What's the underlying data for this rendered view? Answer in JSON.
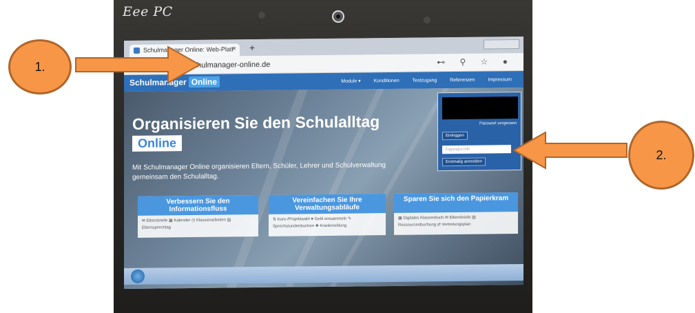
{
  "device": {
    "brand": "Eee PC"
  },
  "browser": {
    "tab_title": "Schulmanager Online: Web-Platt",
    "tab_close": "×",
    "new_tab": "+",
    "url": "schulmanager-online.de",
    "toolbar_icons": "⊷ ⚲ ☆ ●"
  },
  "site": {
    "logo_text": "Schulmanager",
    "logo_badge": "Online",
    "nav": [
      "Module ▾",
      "Konditionen",
      "Testzugang",
      "Referenzen",
      "Impressum"
    ],
    "hero_title": "Organisieren Sie den Schulalltag",
    "hero_badge": "Online",
    "hero_subtitle": "Mit Schulmanager Online organisieren Eltern, Schüler, Lehrer und Schulverwaltung gemeinsam den Schulalltag.",
    "cards": [
      {
        "title": "Verbessern Sie den Informationsfluss",
        "items": "✉ Elternbriefe   ▦ Kalender   ◷ Klassenarbeiten   ▤ Elternsprechtag"
      },
      {
        "title": "Vereinfachen Sie Ihre Verwaltungsabläufe",
        "items": "⇅ Kurs-/Projektwahl   ♥ Geld einsammeln   ✎ Sprechstundenbuchen   ✚ Krankmeldung"
      },
      {
        "title": "Sparen Sie sich den Papierkram",
        "items": "▦ Digitales Klassenbuch   ✉ Elternbriefe   ▤ Ressourcenbuchung   ⇄ Vertretungsplan"
      }
    ],
    "login": {
      "forgot": "Passwort vergessen",
      "login_button": "Einloggen",
      "code_placeholder": "Zugangscode",
      "register_button": "Erstmalig anmelden"
    }
  },
  "annotations": {
    "label_1": "1.",
    "label_2": "2."
  },
  "colors": {
    "annotation": "#f79646",
    "site_blue": "#2e6fb8",
    "accent_blue": "#4a97e0"
  }
}
